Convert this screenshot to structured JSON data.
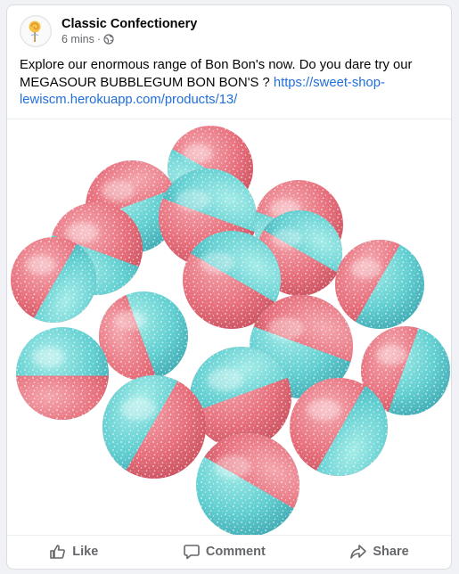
{
  "post": {
    "page_name": "Classic Confectionery",
    "timestamp": "6 mins",
    "separator": "·",
    "audience_icon": "globe-icon",
    "caption_text": "Explore our enormous range of Bon Bon's now. Do you dare try our MEGASOUR BUBBLEGUM BON BON'S ? ",
    "link_text": "https://sweet-shop-lewiscm.herokuapp.com/products/13/"
  },
  "actions": {
    "like_label": "Like",
    "comment_label": "Comment",
    "share_label": "Share"
  },
  "colors": {
    "link": "#216fdb",
    "candy_pink": "#e9707c",
    "candy_blue": "#62cfd1"
  }
}
